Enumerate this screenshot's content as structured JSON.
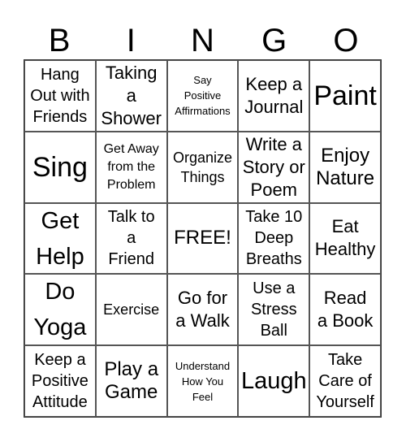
{
  "header": [
    "B",
    "I",
    "N",
    "G",
    "O"
  ],
  "cells": [
    [
      "Hang\nOut with\nFriends",
      "Taking\na\nShower",
      "Say\nPositive\nAffirmations",
      "Keep a\nJournal",
      "Paint"
    ],
    [
      "Sing",
      "Get Away\nfrom the\nProblem",
      "Organize\nThings",
      "Write a\nStory or\nPoem",
      "Enjoy\nNature"
    ],
    [
      "Get\nHelp",
      "Talk to\na\nFriend",
      "FREE!",
      "Take 10\nDeep\nBreaths",
      "Eat\nHealthy"
    ],
    [
      "Do\nYoga",
      "Exercise",
      "Go for\na Walk",
      "Use a\nStress\nBall",
      "Read\na Book"
    ],
    [
      "Keep a\nPositive\nAttitude",
      "Play a\nGame",
      "Understand\nHow You\nFeel",
      "Laugh",
      "Take\nCare of\nYourself"
    ]
  ]
}
